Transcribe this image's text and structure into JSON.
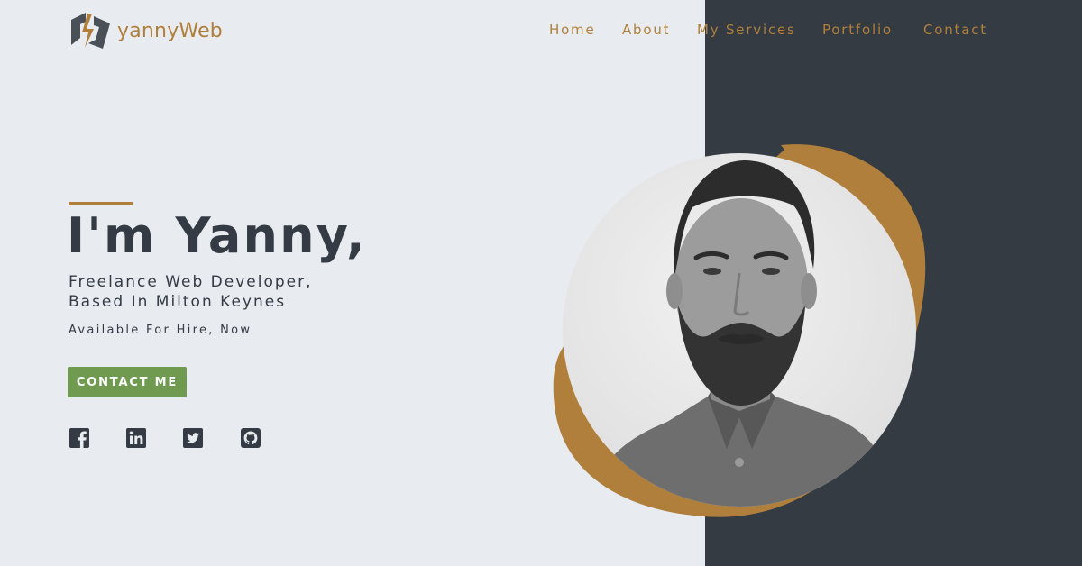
{
  "brand": {
    "name": "yannyWeb",
    "logo_icon": "bolt-logo-icon",
    "accent_color": "#b07f3c"
  },
  "nav": {
    "items": [
      {
        "label": "Home"
      },
      {
        "label": "About"
      },
      {
        "label": "My Services"
      },
      {
        "label": "Portfolio"
      },
      {
        "label": "Contact"
      }
    ]
  },
  "hero": {
    "title": "I'm Yanny,",
    "subtitle_line1": "Freelance Web Developer,",
    "subtitle_line2": "Based In Milton Keynes",
    "availability": "Available For Hire, Now",
    "cta_label": "CONTACT ME",
    "cta_color": "#6f9a50"
  },
  "social": [
    {
      "icon": "facebook-icon"
    },
    {
      "icon": "linkedin-icon"
    },
    {
      "icon": "twitter-icon"
    },
    {
      "icon": "github-icon"
    }
  ],
  "colors": {
    "background": "#e8ecf0",
    "dark_panel": "#343b42",
    "text": "#343b44"
  }
}
